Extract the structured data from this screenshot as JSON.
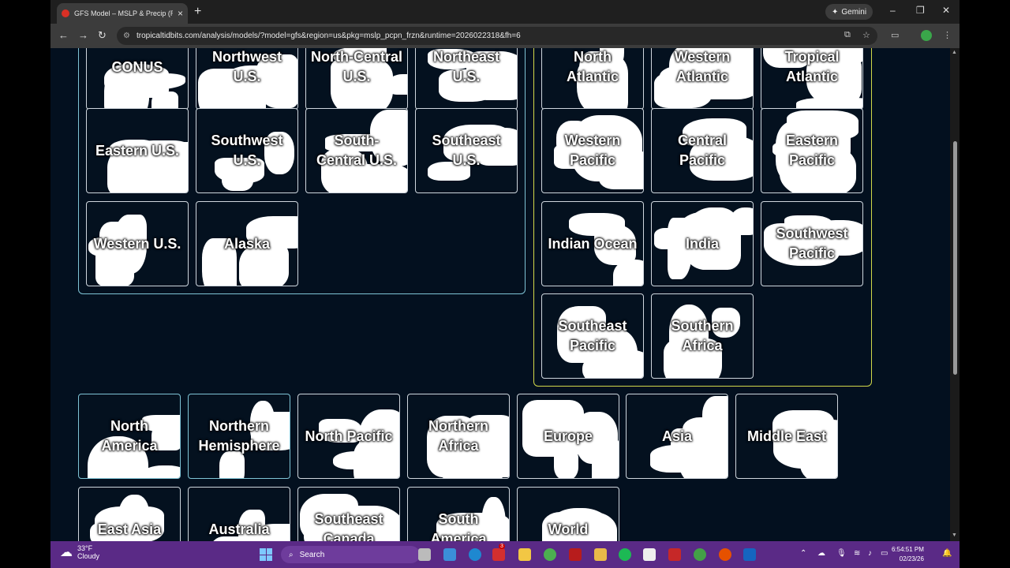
{
  "browser": {
    "tab_title": "GFS Model – MSLP & Precip (Ra",
    "tab_close": "×",
    "new_tab": "+",
    "gemini_label": "Gemini",
    "url": "tropicaltidbits.com/analysis/models/?model=gfs&region=us&pkg=mslp_pcpn_frzn&runtime=2026022318&fh=6",
    "back": "←",
    "forward": "→",
    "reload": "↻",
    "minimize": "–",
    "restore": "❐",
    "close": "✕"
  },
  "us_regions": [
    "CONUS",
    "Northwest U.S.",
    "North-Central U.S.",
    "Northeast U.S.",
    "Eastern U.S.",
    "Southwest U.S.",
    "South-Central U.S.",
    "Southeast U.S.",
    "Western U.S.",
    "Alaska"
  ],
  "tropical_regions": [
    "North Atlantic",
    "Western Atlantic",
    "Tropical Atlantic",
    "Western Pacific",
    "Central Pacific",
    "Eastern Pacific",
    "Indian Ocean",
    "India",
    "Southwest Pacific",
    "Southeast Pacific",
    "Southern Africa"
  ],
  "global_regions": [
    "North America",
    "Northern Hemisphere",
    "North Pacific",
    "Northern Africa",
    "Europe",
    "Asia",
    "Middle East",
    "East Asia",
    "Australia",
    "Southeast Canada",
    "South America",
    "World"
  ],
  "taskbar": {
    "temperature": "33°F",
    "condition": "Cloudy",
    "search_placeholder": "Search",
    "time": "6:54:51 PM",
    "date": "02/23/26",
    "badge": "3"
  },
  "colors": {
    "page_bg": "#03101f",
    "us_group_border": "#7fc4d6",
    "tropics_group_border": "#d2d84a",
    "taskbar": "#5a2a86"
  }
}
